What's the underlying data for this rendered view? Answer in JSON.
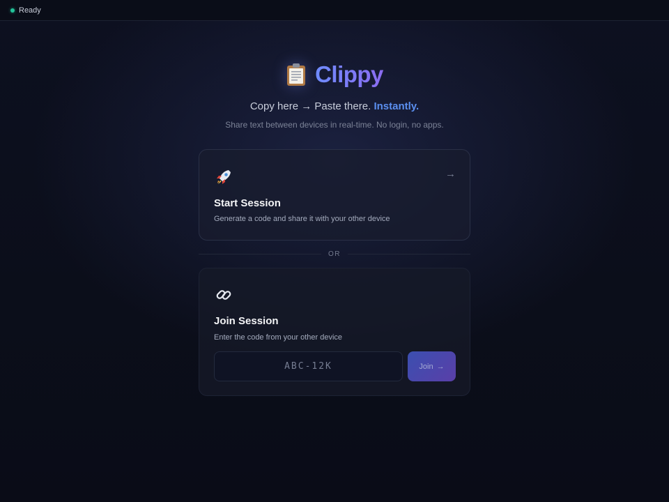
{
  "status": {
    "text": "Ready",
    "color": "#22c39a"
  },
  "brand": {
    "title": "Clippy",
    "icon": "clipboard-icon"
  },
  "tagline": {
    "lead": "Copy here → Paste there.",
    "accent": "Instantly."
  },
  "subtagline": "Share text between devices in real-time. No login, no apps.",
  "start_card": {
    "icon": "rocket-icon",
    "title": "Start Session",
    "description": "Generate a code and share it with your other device",
    "arrow": "→"
  },
  "divider": {
    "label": "OR"
  },
  "join_card": {
    "icon": "link-icon",
    "title": "Join Session",
    "description": "Enter the code from your other device",
    "input": {
      "value": "",
      "placeholder": "ABC-12K"
    },
    "button": {
      "label": "Join",
      "arrow": "→"
    }
  },
  "colors": {
    "accent": "#5b8ff0",
    "brand_start": "#6f8cff",
    "brand_end": "#8b6cf0"
  }
}
